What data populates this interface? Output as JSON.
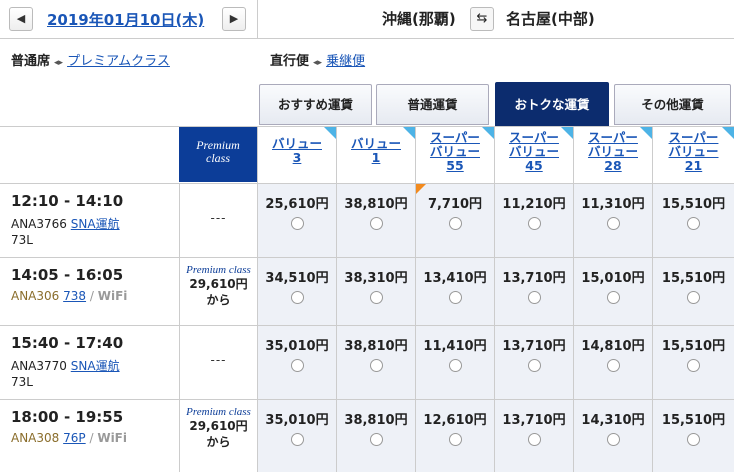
{
  "header": {
    "date": "2019年01月10日(木)",
    "prev": "◀",
    "next": "▶",
    "from": "沖縄(那覇)",
    "to": "名古屋(中部)",
    "swap": "⇆"
  },
  "cabin": {
    "current": "普通席",
    "alt": "プレミアムクラス"
  },
  "route": {
    "current": "直行便",
    "alt": "乗継便"
  },
  "arrow": "◂▸",
  "tabs": [
    "おすすめ運賃",
    "普通運賃",
    "おトクな運賃",
    "その他運賃"
  ],
  "premium_header": [
    "Premium",
    "class"
  ],
  "fares": [
    {
      "l1": "バリュー",
      "l2": "3"
    },
    {
      "l1": "バリュー",
      "l2": "1"
    },
    {
      "l1": "スーパー",
      "l2": "バリュー",
      "l3": "55"
    },
    {
      "l1": "スーパー",
      "l2": "バリュー",
      "l3": "45"
    },
    {
      "l1": "スーパー",
      "l2": "バリュー",
      "l3": "28"
    },
    {
      "l1": "スーパー",
      "l2": "バリュー",
      "l3": "21"
    }
  ],
  "flights": [
    {
      "time": "12:10 - 14:10",
      "no": "ANA3766",
      "op": "SNA運航",
      "ac": "73L",
      "wifi": "",
      "premium": "---",
      "prices": [
        "25,610円",
        "38,810円",
        "7,710円",
        "11,210円",
        "11,310円",
        "15,510円"
      ]
    },
    {
      "time": "14:05 - 16:05",
      "no": "ANA306",
      "op": "738",
      "ac": "",
      "wifi": "WiFi",
      "premium": "Premium class",
      "pprice": "29,610円",
      "pfrom": "から",
      "prices": [
        "34,510円",
        "38,310円",
        "13,410円",
        "13,710円",
        "15,010円",
        "15,510円"
      ]
    },
    {
      "time": "15:40 - 17:40",
      "no": "ANA3770",
      "op": "SNA運航",
      "ac": "73L",
      "wifi": "",
      "premium": "---",
      "prices": [
        "35,010円",
        "38,810円",
        "11,410円",
        "13,710円",
        "14,810円",
        "15,510円"
      ]
    },
    {
      "time": "18:00 - 19:55",
      "no": "ANA308",
      "op": "76P",
      "ac": "",
      "wifi": "WiFi",
      "premium": "Premium class",
      "pprice": "29,610円",
      "pfrom": "から",
      "prices": [
        "35,010円",
        "38,810円",
        "12,610円",
        "13,710円",
        "14,310円",
        "15,510円"
      ]
    }
  ]
}
